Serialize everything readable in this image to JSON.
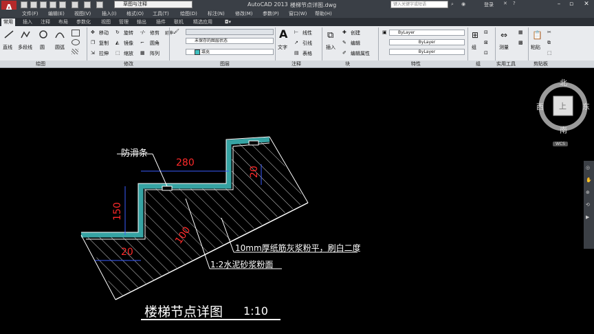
{
  "app": {
    "logo_letter": "A",
    "title": "AutoCAD 2013",
    "filename": "楼梯节点详图.dwg"
  },
  "workspace": {
    "selected": "草图与注释"
  },
  "search": {
    "placeholder": "键入关键字或短语"
  },
  "user": {
    "login": "登录"
  },
  "menu": [
    "文件(F)",
    "编辑(E)",
    "视图(V)",
    "插入(I)",
    "格式(O)",
    "工具(T)",
    "绘图(D)",
    "标注(N)",
    "修改(M)",
    "参数(P)",
    "窗口(W)",
    "帮助(H)"
  ],
  "tabs": [
    "常用",
    "插入",
    "注释",
    "布局",
    "参数化",
    "视图",
    "管理",
    "输出",
    "插件",
    "联机",
    "精选应用"
  ],
  "ribbon": {
    "draw": {
      "line": "直线",
      "polyline": "多段线",
      "circle": "圆",
      "arc": "圆弧"
    },
    "modify": {
      "move": "移动",
      "rotate": "旋转",
      "trim": "修剪",
      "copy": "复制",
      "mirror": "镜像",
      "fillet": "圆角",
      "stretch": "拉伸",
      "scale": "缩放",
      "array": "阵列",
      "extend": "延伸"
    },
    "layers": {
      "state": "未保存的图层状态",
      "layer_name": "填充"
    },
    "annotation": {
      "text": "文字",
      "linear": "线性",
      "leader": "引线",
      "table": "表格"
    },
    "block": {
      "insert": "插入",
      "create": "创建",
      "edit": "编辑",
      "edit_attr": "编辑属性"
    },
    "properties": {
      "color": "ByLayer",
      "linetype": "ByLayer",
      "lineweight": "ByLayer"
    },
    "groups": {
      "group": "组"
    },
    "utilities": {
      "measure": "测量"
    },
    "clipboard": {
      "paste": "粘贴"
    }
  },
  "panels": [
    "绘图",
    "修改",
    "图层",
    "注释",
    "块",
    "特性",
    "组",
    "实用工具",
    "剪贴板"
  ],
  "viewcube": {
    "north": "北",
    "south": "南",
    "east": "东",
    "west": "西",
    "top": "上",
    "ucs": "WCS"
  },
  "drawing": {
    "labels": {
      "anti_slip": "防滑条",
      "finish1": "10mm厚纸筋灰浆粉平，刷白二度",
      "finish2": "1:2水泥砂浆粉面",
      "title": "楼梯节点详图",
      "scale": "1:10"
    },
    "dimensions": {
      "tread": "280",
      "riser": "150",
      "nosing": "20",
      "slab": "100",
      "edge": "20"
    }
  },
  "colors": {
    "accent": "#b52a2a",
    "dimension": "#ff2a2a",
    "hatch": "#3fbfbf",
    "blue_line": "#3a5bff"
  }
}
